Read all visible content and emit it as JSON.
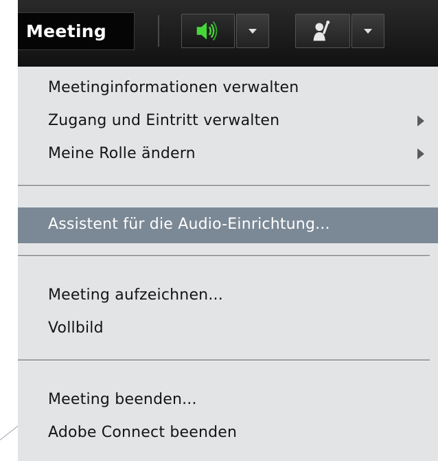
{
  "toolbar": {
    "meeting_label": "Meeting",
    "audio_icon": "speaker-icon",
    "hand_icon": "raise-hand-icon",
    "accent_color": "#47d63a"
  },
  "menu": {
    "items": [
      {
        "label": "Meetinginformationen verwalten",
        "submenu": false
      },
      {
        "label": "Zugang und Eintritt verwalten",
        "submenu": true
      },
      {
        "label": "Meine Rolle ändern",
        "submenu": true
      },
      {
        "label": "Assistent für die Audio-Einrichtung...",
        "highlighted": true
      },
      {
        "label": "Meeting aufzeichnen..."
      },
      {
        "label": "Vollbild"
      },
      {
        "label": "Meeting beenden..."
      },
      {
        "label": "Adobe Connect beenden"
      }
    ],
    "highlight_color": "#7b8895"
  }
}
